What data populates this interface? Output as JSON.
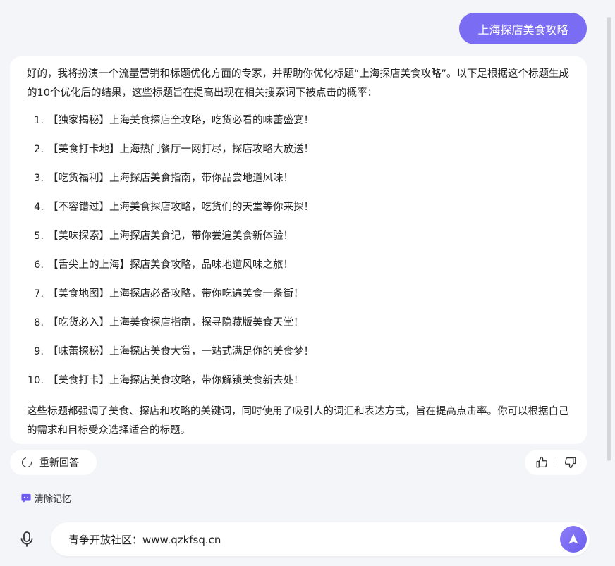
{
  "user_message": "上海探店美食攻略",
  "answer": {
    "intro": "好的，我将扮演一个流量营销和标题优化方面的专家，并帮助你优化标题“上海探店美食攻略”。以下是根据这个标题生成的10个优化后的结果，这些标题旨在提高出现在相关搜索词下被点击的概率：",
    "items": [
      {
        "num": "1.",
        "text": "【独家揭秘】上海美食探店全攻略，吃货必看的味蕾盛宴！"
      },
      {
        "num": "2.",
        "text": "【美食打卡地】上海热门餐厅一网打尽，探店攻略大放送！"
      },
      {
        "num": "3.",
        "text": "【吃货福利】上海探店美食指南，带你品尝地道风味！"
      },
      {
        "num": "4.",
        "text": "【不容错过】上海美食探店攻略，吃货们的天堂等你来探！"
      },
      {
        "num": "5.",
        "text": "【美味探索】上海探店美食记，带你尝遍美食新体验！"
      },
      {
        "num": "6.",
        "text": "【舌尖上的上海】探店美食攻略，品味地道风味之旅！"
      },
      {
        "num": "7.",
        "text": "【美食地图】上海探店必备攻略，带你吃遍美食一条街！"
      },
      {
        "num": "8.",
        "text": "【吃货必入】上海美食探店指南，探寻隐藏版美食天堂！"
      },
      {
        "num": "9.",
        "text": "【味蕾探秘】上海探店美食大赏，一站式满足你的美食梦！"
      },
      {
        "num": "10.",
        "text": "【美食打卡】上海探店美食攻略，带你解锁美食新去处！"
      }
    ],
    "outro": "这些标题都强调了美食、探店和攻略的关键词，同时使用了吸引人的词汇和表达方式，旨在提高点击率。你可以根据自己的需求和目标受众选择适合的标题。"
  },
  "actions": {
    "retry_label": "重新回答",
    "clear_memory_label": "清除记忆",
    "thumbs_up_icon": "thumbs-up-icon",
    "thumbs_down_icon": "thumbs-down-icon"
  },
  "input": {
    "value": "青争开放社区：www.qzkfsq.cn"
  },
  "colors": {
    "accent": "#7b6cf4",
    "background": "#f4f5f9",
    "card": "#ffffff"
  }
}
